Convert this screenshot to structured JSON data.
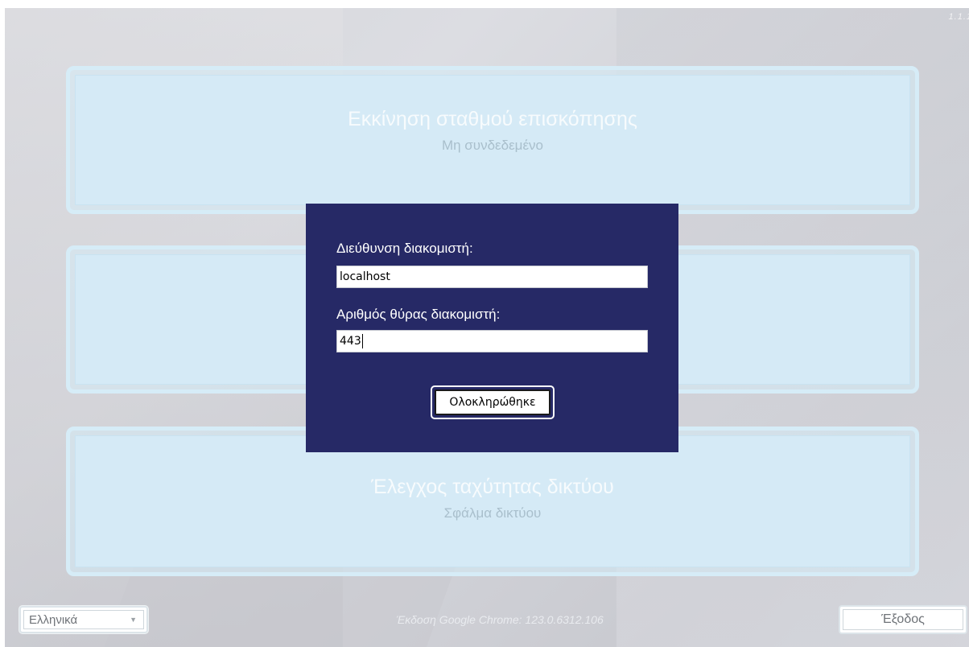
{
  "app": {
    "version_corner": "1.1.1",
    "tiles": [
      {
        "title": "Εκκίνηση σταθμού επισκόπησης",
        "status": "Μη συνδεδεμένο"
      },
      {
        "title": "",
        "status": ""
      },
      {
        "title": "Έλεγχος ταχύτητας δικτύου",
        "status": "Σφάλμα δικτύου"
      }
    ],
    "footer": {
      "language": "Ελληνικά",
      "browser_version": "Έκδοση Google Chrome:  123.0.6312.106",
      "exit_label": "Έξοδος"
    }
  },
  "dialog": {
    "server_address_label": "Διεύθυνση διακομιστή:",
    "server_address_value": "localhost",
    "server_port_label": "Αριθμός θύρας διακομιστή:",
    "server_port_value": "443",
    "done_label": "Ολοκληρώθηκε"
  },
  "colors": {
    "dialog_bg": "#262966",
    "tile_bg": "#d5eaf6"
  }
}
